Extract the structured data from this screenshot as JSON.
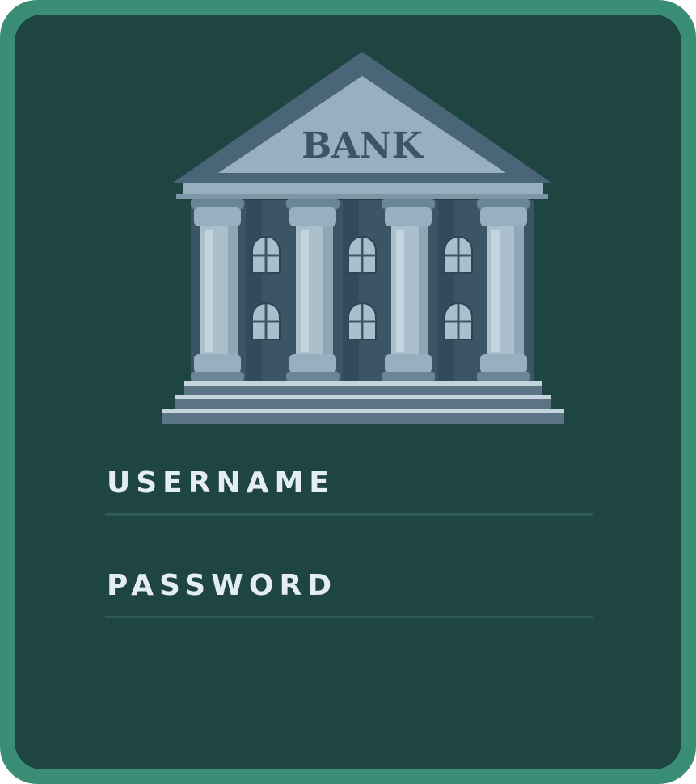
{
  "logo": {
    "icon": "bank-building-icon",
    "sign_text": "BANK"
  },
  "form": {
    "username_label": "USERNAME",
    "password_label": "PASSWORD"
  },
  "colors": {
    "frame": "#3a8e75",
    "card": "#1e4541",
    "label_text": "#e4eef2",
    "field_line": "#2e5a58",
    "pediment_dark": "#4a6478",
    "pediment_light": "#97afbf",
    "column_light": "#a9bfcc",
    "wall": "#3c5566"
  }
}
